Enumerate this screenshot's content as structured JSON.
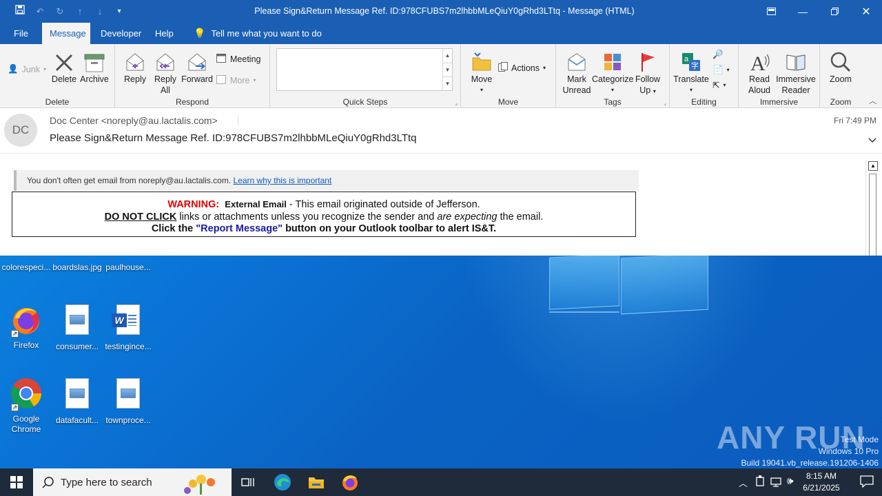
{
  "window": {
    "title": "Please Sign&Return Message Ref. ID:978CFUBS7m2lhbbMLeQiuY0gRhd3LTtq  -  Message (HTML)"
  },
  "tabs": [
    {
      "label": "File"
    },
    {
      "label": "Message"
    },
    {
      "label": "Developer"
    },
    {
      "label": "Help"
    }
  ],
  "tell_me": "Tell me what you want to do",
  "ribbon": {
    "delete_group": {
      "label": "Delete",
      "junk": "Junk",
      "delete": "Delete",
      "archive": "Archive"
    },
    "respond_group": {
      "label": "Respond",
      "reply": "Reply",
      "reply_all_1": "Reply",
      "reply_all_2": "All",
      "forward": "Forward",
      "meeting": "Meeting",
      "more": "More"
    },
    "quick_steps_group": {
      "label": "Quick Steps"
    },
    "move_group": {
      "label": "Move",
      "move": "Move",
      "actions": "Actions"
    },
    "tags_group": {
      "label": "Tags",
      "mark_unread_1": "Mark",
      "mark_unread_2": "Unread",
      "categorize": "Categorize",
      "follow_up_1": "Follow",
      "follow_up_2": "Up"
    },
    "editing_group": {
      "label": "Editing",
      "translate": "Translate"
    },
    "immersive_group": {
      "label": "Immersive",
      "read_aloud_1": "Read",
      "read_aloud_2": "Aloud",
      "immersive_reader_1": "Immersive",
      "immersive_reader_2": "Reader"
    },
    "zoom_group": {
      "label": "Zoom",
      "zoom": "Zoom"
    }
  },
  "message": {
    "avatar_initials": "DC",
    "from": "Doc Center <noreply@au.lactalis.com>",
    "subject": "Please Sign&Return Message Ref. ID:978CFUBS7m2lhbbMLeQiuY0gRhd3LTtq",
    "date": "Fri 7:49 PM",
    "infobar_text": "You don't often get email from noreply@au.lactalis.com.",
    "infobar_link": "Learn why this is important",
    "warning": {
      "label": "WARNING:",
      "external": "External Email",
      "line1_rest": " - This email originated outside of Jefferson.",
      "do_not_click": "DO NOT CLICK",
      "line2_a": " links or attachments unless you recognize the sender and ",
      "line2_em": "are expecting",
      "line2_b": " the email.",
      "line3_a": "Click the ",
      "line3_quote": "\"Report Message\"",
      "line3_b": " button on your Outlook toolbar to alert IS&T."
    }
  },
  "desktop": {
    "icons_row1": [
      {
        "label": "colorespeci..."
      },
      {
        "label": "boardslas.jpg"
      },
      {
        "label": "paulhouse..."
      }
    ],
    "icons_row2": [
      {
        "label": "Firefox"
      },
      {
        "label": "consumer..."
      },
      {
        "label": "testingince..."
      }
    ],
    "icons_row3": [
      {
        "label": "Google Chrome"
      },
      {
        "label": "datafacult..."
      },
      {
        "label": "townproce..."
      }
    ]
  },
  "watermark": {
    "line1": "Test Mode",
    "line2": "Windows 10 Pro",
    "line3": "Build 19041.vb_release.191206-1406",
    "brand": "ANY RUN"
  },
  "taskbar": {
    "search_placeholder": "Type here to search",
    "time": "8:15 AM",
    "date": "6/21/2025"
  },
  "colors": {
    "outlook_blue": "#1a5fb4",
    "desktop_blue": "#0a74d6",
    "warning_red": "#e00000"
  }
}
